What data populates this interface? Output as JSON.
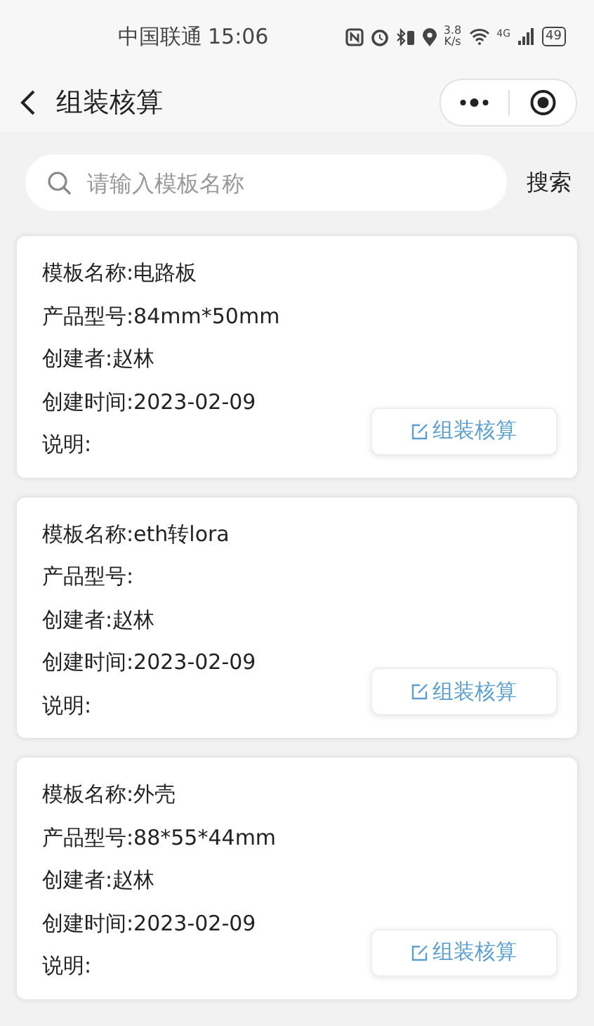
{
  "status_bar": {
    "carrier": "中国联通",
    "time": "15:06",
    "speed": "3.8\nK/s",
    "network": "4G",
    "battery": "49"
  },
  "header": {
    "title": "组装核算"
  },
  "search": {
    "placeholder": "请输入模板名称",
    "button": "搜索"
  },
  "templates": [
    {
      "fields": [
        "模板名称:电路板",
        "产品型号:84mm*50mm",
        "创建者:赵林",
        "创建时间:2023-02-09",
        "说明:"
      ],
      "action": "组装核算"
    },
    {
      "fields": [
        "模板名称:eth转lora",
        "产品型号:",
        "创建者:赵林",
        "创建时间:2023-02-09",
        "说明:"
      ],
      "action": "组装核算"
    },
    {
      "fields": [
        "模板名称:外壳",
        "产品型号:88*55*44mm",
        "创建者:赵林",
        "创建时间:2023-02-09",
        "说明:"
      ],
      "action": "组装核算"
    }
  ]
}
